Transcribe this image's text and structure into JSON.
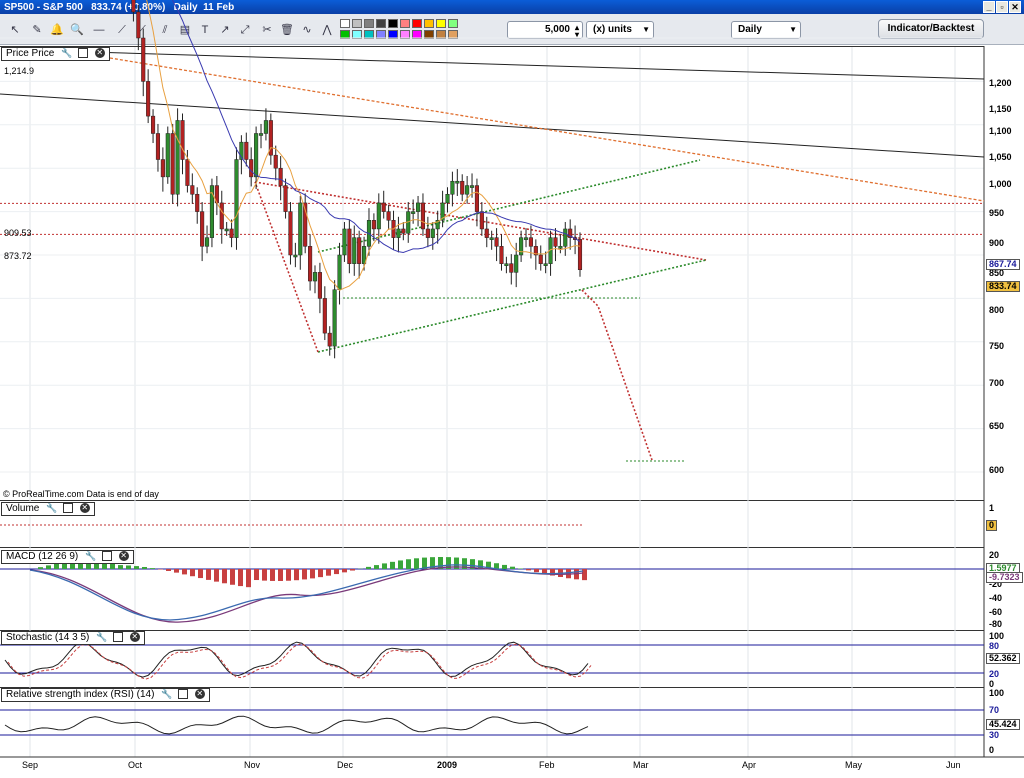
{
  "window": {
    "title": "SP500 - S&P 500   833.74 (+0.80%)   Daily  11 Feb",
    "controls": [
      "_",
      "▫",
      "✕"
    ]
  },
  "toolbar": {
    "units_value": "5,000",
    "units_label": "(x) units",
    "period": "Daily",
    "indicator_button": "Indicator/Backtest",
    "palette": [
      "#ffffff",
      "#c0c0c0",
      "#808080",
      "#404040",
      "#000000",
      "#ff8080",
      "#ff0000",
      "#ffc000",
      "#ffff00",
      "#80ff80",
      "#00c000",
      "#80ffff",
      "#00c0c0",
      "#8080ff",
      "#0000ff",
      "#ff80ff",
      "#ff00ff",
      "#804000",
      "#c08040",
      "#e0a060"
    ]
  },
  "price_panel": {
    "title": "Price Price",
    "watermark": "© ProRealTime.com  Data is end of day",
    "levels": [
      {
        "label": "1,214.9",
        "value": 1214.9
      },
      {
        "label": "909.53",
        "value": 909.53
      },
      {
        "label": "873.72",
        "value": 873.72
      }
    ],
    "axis_ticks": [
      "1,200",
      "1,150",
      "1,100",
      "1,050",
      "1,000",
      "950",
      "900",
      "850",
      "800",
      "750",
      "700",
      "650",
      "600"
    ],
    "last_price_tags": [
      "867.74",
      "833.74"
    ],
    "colors": {
      "up": "#2e8b2e",
      "down": "#b22222",
      "ma_fast": "#e8a040",
      "ma_slow": "#3a3ab0",
      "support": "#2a8a2a",
      "resistance": "#c03030",
      "trend": "#e07030"
    }
  },
  "volume_panel": {
    "title": "Volume",
    "axis_ticks": [
      "1"
    ],
    "value_tag": "0"
  },
  "macd_panel": {
    "title": "MACD (12 26 9)",
    "axis_ticks": [
      "20",
      "0",
      "-20",
      "-40",
      "-60",
      "-80"
    ],
    "value_tags": [
      "1.5977",
      "-9.7323"
    ]
  },
  "stoch_panel": {
    "title": "Stochastic (14 3 5)",
    "axis_ticks": [
      "100",
      "80",
      "20",
      "0"
    ],
    "value_tag": "52.362"
  },
  "rsi_panel": {
    "title": "Relative strength index (RSI) (14)",
    "axis_ticks": [
      "100",
      "70",
      "30",
      "0"
    ],
    "value_tag": "45.424"
  },
  "time_axis": [
    "Sep",
    "Oct",
    "Nov",
    "Dec",
    "2009",
    "Feb",
    "Mar",
    "Apr",
    "May",
    "Jun"
  ]
}
